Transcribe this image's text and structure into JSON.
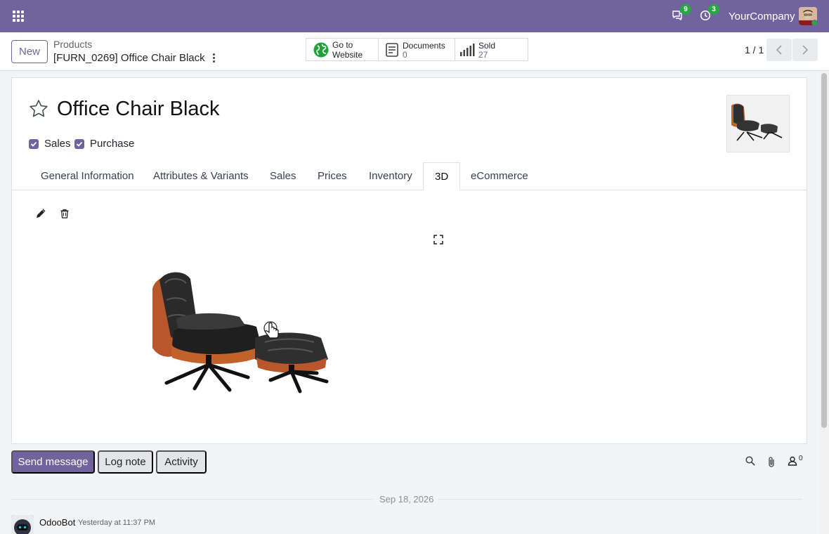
{
  "navbar": {
    "apps_icon": "apps-grid-icon",
    "messages_icon": "chat-icon",
    "messages_count": "9",
    "activities_icon": "clock-icon",
    "activities_count": "3",
    "company": "YourCompany",
    "accent": "#71639e"
  },
  "control_panel": {
    "new_label": "New",
    "breadcrumb_parent": "Products",
    "breadcrumb_current": "[FURN_0269] Office Chair Black",
    "smart_buttons": [
      {
        "icon": "globe-icon",
        "line1": "Go to",
        "line2": "Website"
      },
      {
        "icon": "document-icon",
        "label": "Documents",
        "value": "0"
      },
      {
        "icon": "bar-chart-icon",
        "label": "Sold",
        "value": "27"
      }
    ],
    "pager": "1 / 1"
  },
  "product": {
    "name": "Office Chair Black",
    "sales_label": "Sales",
    "sales_checked": true,
    "purchase_label": "Purchase",
    "purchase_checked": true
  },
  "tabs": [
    {
      "label": "General Information"
    },
    {
      "label": "Attributes & Variants"
    },
    {
      "label": "Sales"
    },
    {
      "label": "Prices"
    },
    {
      "label": "Inventory"
    },
    {
      "label": "3D",
      "active": true
    },
    {
      "label": "eCommerce"
    }
  ],
  "chatter": {
    "send_message": "Send message",
    "log_note": "Log note",
    "activity": "Activity",
    "followers_count": "0",
    "date_separator": "Sep 18, 2026",
    "author": "OdooBot",
    "timestamp": "Yesterday at 11:37 PM"
  }
}
